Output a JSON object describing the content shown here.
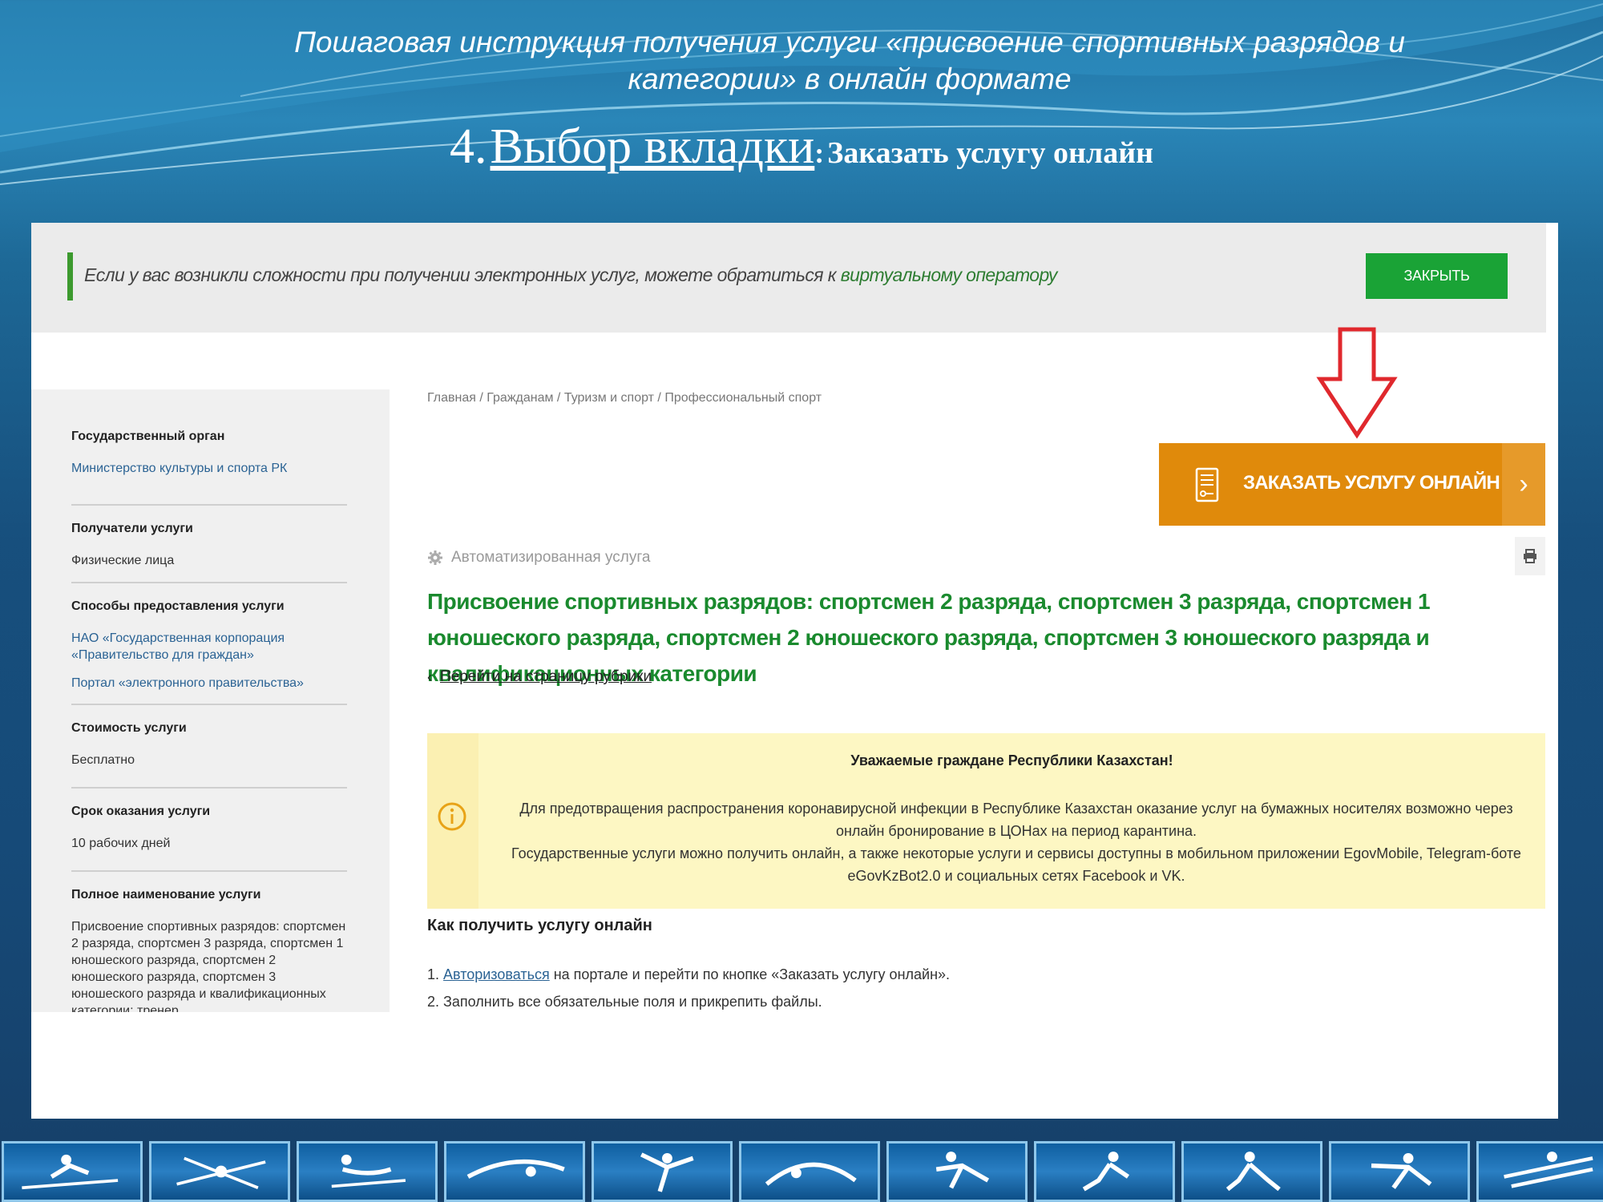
{
  "slide": {
    "title": "Пошаговая инструкция получения услуги «присвоение спортивных разрядов и категории» в онлайн формате",
    "step_number": "4.",
    "step_tab_name": "Выбор вкладки",
    "step_colon": ":",
    "step_tab_value": "Заказать услугу онлайн"
  },
  "notice": {
    "text": "Если у вас возникли сложности при получении электронных услуг, можете обратиться к ",
    "link": "виртуальному оператору",
    "close_label": "ЗАКРЫТЬ"
  },
  "sidebar": {
    "blocks": [
      {
        "heading": "Государственный орган",
        "value": "Министерство культуры и спорта РК"
      },
      {
        "heading": "Получатели услуги",
        "value": "Физические лица"
      },
      {
        "heading": "Способы предоставления услуги",
        "value": "НАО «Государственная корпорация «Правительство для граждан»",
        "value2": "Портал «электронного правительства»"
      },
      {
        "heading": "Стоимость услуги",
        "value": "Бесплатно"
      },
      {
        "heading": "Срок оказания услуги",
        "value": "10 рабочих дней"
      },
      {
        "heading": "Полное наименование услуги",
        "value": "Присвоение спортивных разрядов: спортсмен 2 разряда, спортсмен 3 разряда, спортсмен 1 юношеского разряда, спортсмен 2 юношеского разряда, спортсмен 3 юношеского разряда и квалификационных категории: тренер"
      }
    ]
  },
  "breadcrumb": [
    "Главная",
    "Гражданам",
    "Туризм и спорт",
    "Профессиональный спорт"
  ],
  "breadcrumb_separator": " / ",
  "order_button": {
    "label": "ЗАКАЗАТЬ УСЛУГУ ОНЛАЙН",
    "icon": "document-icon",
    "chevron": "›"
  },
  "automated_label": "Автоматизированная услуга",
  "service_title": "Присвоение спортивных разрядов: спортсмен 2 разряда, спортсмен 3 разряда, спортсмен 1 юношеского разряда, спортсмен 2 юношеского разряда, спортсмен 3 юношеского разряда и квалификационных категории",
  "rubric_link": "Перейти на страницу рубрики",
  "alert": {
    "title": "Уважаемые граждане Республики Казахстан!",
    "body_line1": "Для предотвращения распространения коронавирусной инфекции в Республике Казахстан оказание услуг на бумажных носителях возможно через онлайн бронирование в ЦОНах на период карантина.",
    "body_line2": "Государственные услуги можно получить онлайн, а также некоторые услуги и сервисы доступны в мобильном приложении EgovMobile, Telegram-боте eGovKzBot2.0 и социальных сетях Facebook и VK."
  },
  "howto": {
    "title": "Как получить услугу онлайн",
    "step1_prefix": "1. ",
    "step1_link": "Авторизоваться",
    "step1_rest": " на портале и перейти по кнопке «Заказать услугу онлайн».",
    "step2": "2. Заполнить все обязательные поля и прикрепить файлы."
  },
  "colors": {
    "accent_green": "#1aa336",
    "title_green": "#1a8a2e",
    "order_orange": "#e08a0b",
    "alert_yellow": "#fdf7c3",
    "arrow_red": "#e0282d"
  }
}
